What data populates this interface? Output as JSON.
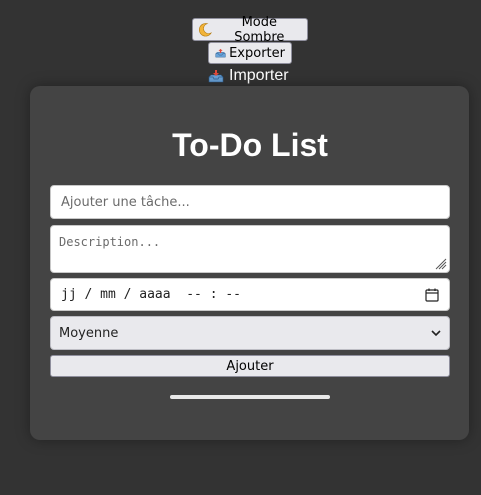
{
  "header": {
    "dark_mode_label": "Mode Sombre",
    "export_label": "Exporter",
    "import_label": "Importer"
  },
  "main": {
    "title": "To-Do List",
    "task_input": {
      "placeholder": "Ajouter une tâche..."
    },
    "description_input": {
      "placeholder": "Description..."
    },
    "datetime_input": {
      "value_display": "jj / mm / aaaa  -- : --"
    },
    "priority_select": {
      "selected": "Moyenne"
    },
    "add_button_label": "Ajouter"
  },
  "colors": {
    "background": "#333333",
    "card": "#444444",
    "text_light": "#ffffff",
    "button": "#e9e9ed"
  },
  "icons": {
    "dark_mode": "moon-icon",
    "export": "outbox-tray-icon",
    "import": "inbox-tray-icon",
    "calendar": "calendar-icon",
    "dropdown": "chevron-down-icon",
    "resize": "resize-grip-icon"
  }
}
